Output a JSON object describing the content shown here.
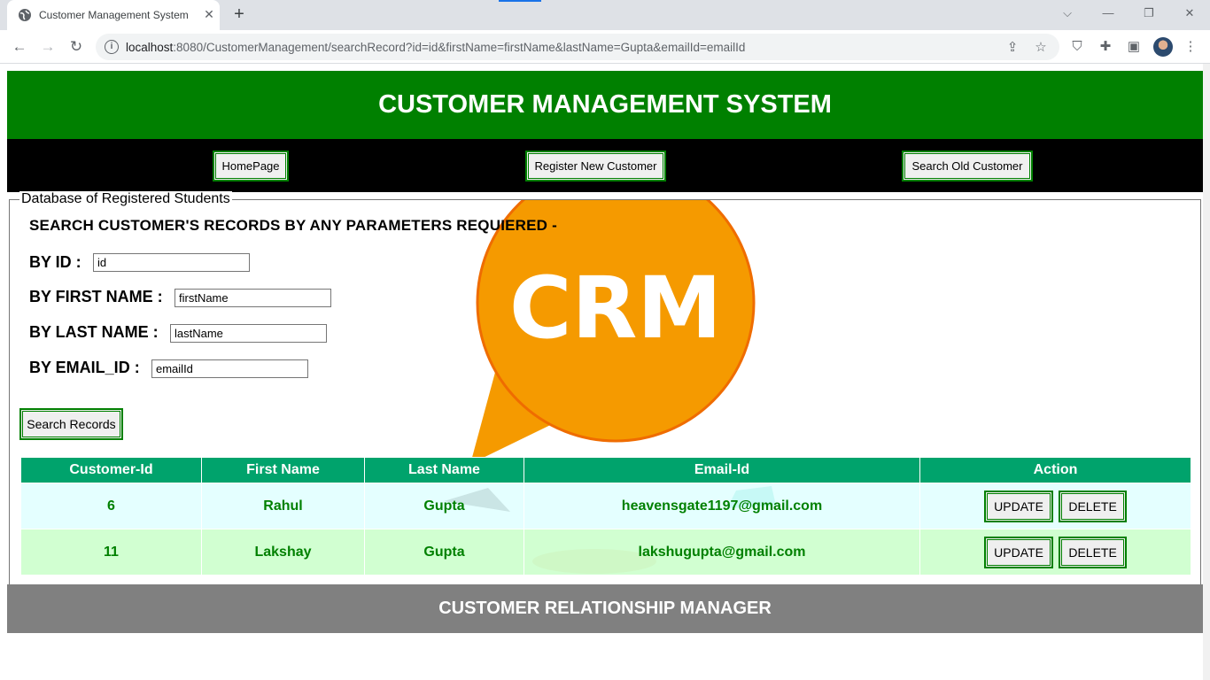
{
  "browser": {
    "tab_title": "Customer Management System",
    "tab_close": "✕",
    "new_tab": "+",
    "url_host": "localhost",
    "url_rest": ":8080/CustomerManagement/searchRecord?id=id&firstName=firstName&lastName=Gupta&emailId=emailId",
    "window_controls": {
      "dropdown": "⌵",
      "minimize": "—",
      "restore": "❐",
      "close": "✕"
    }
  },
  "header": {
    "title": "CUSTOMER MANAGEMENT SYSTEM"
  },
  "nav": {
    "home": "HomePage",
    "register": "Register New Customer",
    "search": "Search Old Customer"
  },
  "panel": {
    "legend": "Database of Registered Students",
    "search_title": "SEARCH CUSTOMER'S RECORDS BY ANY PARAMETERS REQUIERED -",
    "graphic_text": "CRM",
    "fields": {
      "id_label": "BY ID :",
      "id_value": "id",
      "first_label": "BY FIRST NAME :",
      "first_value": "firstName",
      "last_label": "BY LAST NAME :",
      "last_value": "lastName",
      "email_label": "BY EMAIL_ID :",
      "email_value": "emailId"
    },
    "search_button": "Search Records"
  },
  "table": {
    "headers": [
      "Customer-Id",
      "First Name",
      "Last Name",
      "Email-Id",
      "Action"
    ],
    "rows": [
      {
        "id": "6",
        "first": "Rahul",
        "last": "Gupta",
        "email": "heavensgate1197@gmail.com"
      },
      {
        "id": "11",
        "first": "Lakshay",
        "last": "Gupta",
        "email": "lakshugupta@gmail.com"
      }
    ],
    "update_label": "UPDATE",
    "delete_label": "DELETE"
  },
  "footer": {
    "text": "CUSTOMER RELATIONSHIP MANAGER"
  },
  "colors": {
    "green": "#008000",
    "table_header": "#00a36c",
    "footer": "#808080",
    "crm_orange": "#f59a00"
  }
}
